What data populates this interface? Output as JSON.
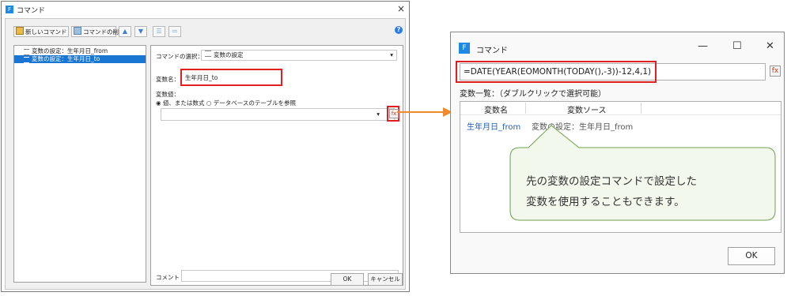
{
  "left_dialog": {
    "title": "コマンド",
    "close_glyph": "×",
    "toolbar": {
      "new_command_label": "新しいコマンド",
      "delete_command_label": "コマンドの削除",
      "move_up_glyph": "▲",
      "move_down_glyph": "▼",
      "help_glyph": "?"
    },
    "tree_items": [
      {
        "label": "変数の設定：生年月日_from",
        "selected": false
      },
      {
        "label": "変数の設定：生年月日_to",
        "selected": true
      }
    ],
    "command_select": {
      "label": "コマンドの選択：",
      "value": "変数の設定",
      "arrow": "▾"
    },
    "var_name": {
      "label": "変数名：",
      "value": "生年月日_to"
    },
    "var_value": {
      "label": "変数値：",
      "option_literal": "値、または数式",
      "option_table": "データベースのテーブルを参照",
      "selected": "option_literal",
      "dropdown_arrow": "▾"
    },
    "comment_label": "コメント",
    "ok_label": "OK",
    "cancel_label": "キャンセル"
  },
  "right_dialog": {
    "title": "コマンド",
    "minimize_glyph": "—",
    "maximize_glyph": "☐",
    "close_glyph": "✕",
    "formula": "=DATE(YEAR(EOMONTH(TODAY(),-3))-12,4,1)",
    "var_list_label": "変数一覧：（ダブルクリックで選択可能）",
    "columns": [
      "変数名",
      "変数ソース"
    ],
    "rows": [
      {
        "name": "生年月日_from",
        "source": "変数の設定：生年月日_from"
      }
    ],
    "callout_lines": [
      "先の変数の設定コマンドで設定した",
      "変数を使用することもできます。"
    ],
    "ok_label": "OK"
  },
  "colors": {
    "highlight_red": "#e02020",
    "selection_blue": "#1976d2",
    "arrow_orange": "#f08a2c",
    "callout_fill": "#f3f8ec",
    "callout_border": "#6d9f48",
    "link_blue": "#1e5fb4"
  }
}
